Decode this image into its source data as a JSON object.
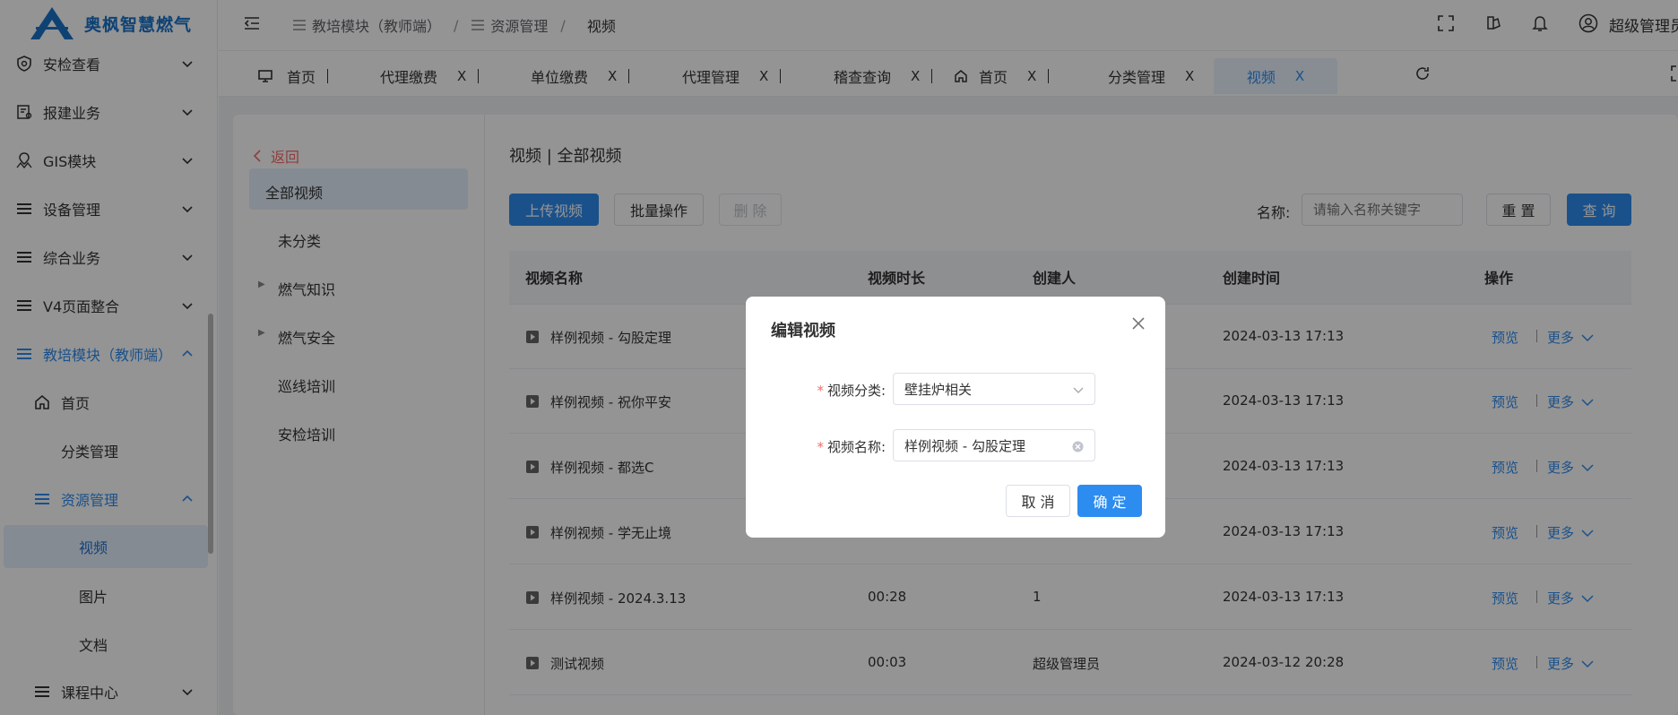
{
  "app": {
    "name": "奥枫智慧燃气"
  },
  "sidebar": {
    "items": [
      {
        "label": "安检查看",
        "icon": "shield-icon"
      },
      {
        "label": "报建业务",
        "icon": "form-icon"
      },
      {
        "label": "GIS模块",
        "icon": "map-icon"
      },
      {
        "label": "设备管理",
        "icon": "menu-icon"
      },
      {
        "label": "综合业务",
        "icon": "menu-icon"
      },
      {
        "label": "V4页面整合",
        "icon": "menu-icon"
      },
      {
        "label": "教培模块（教师端）",
        "icon": "menu-icon"
      },
      {
        "label": "首页",
        "icon": "home-icon"
      },
      {
        "label": "分类管理"
      },
      {
        "label": "资源管理",
        "icon": "menu-icon"
      },
      {
        "label": "视频"
      },
      {
        "label": "图片"
      },
      {
        "label": "文档"
      },
      {
        "label": "课程中心",
        "icon": "menu-icon"
      }
    ]
  },
  "header": {
    "breadcrumb": [
      "教培模块（教师端）",
      "资源管理",
      "视频"
    ],
    "user": "超级管理员"
  },
  "tabs": [
    "首页",
    "代理缴费",
    "单位缴费",
    "代理管理",
    "稽查查询",
    "首页",
    "分类管理",
    "视频"
  ],
  "tab_close": "X",
  "leftnav": {
    "back": "返回",
    "items": [
      "全部视频",
      "未分类",
      "燃气知识",
      "燃气安全",
      "巡线培训",
      "安检培训"
    ]
  },
  "main": {
    "title": "视频 | 全部视频",
    "upload": "上传视频",
    "batch": "批量操作",
    "delete": "删 除",
    "name_label": "名称:",
    "name_placeholder": "请输入名称关键字",
    "reset": "重 置",
    "query": "查 询"
  },
  "table": {
    "headers": [
      "视频名称",
      "视频时长",
      "创建人",
      "创建时间",
      "操作"
    ],
    "rows": [
      {
        "name": "样例视频 - 勾股定理",
        "duration": "",
        "creator": "",
        "time": "2024-03-13 17:13"
      },
      {
        "name": "样例视频 - 祝你平安",
        "duration": "",
        "creator": "",
        "time": "2024-03-13 17:13"
      },
      {
        "name": "样例视频 - 都选C",
        "duration": "",
        "creator": "",
        "time": "2024-03-13 17:13"
      },
      {
        "name": "样例视频 - 学无止境",
        "duration": "",
        "creator": "",
        "time": "2024-03-13 17:13"
      },
      {
        "name": "样例视频 - 2024.3.13",
        "duration": "00:28",
        "creator": "1",
        "time": "2024-03-13 17:13"
      },
      {
        "name": "测试视频",
        "duration": "00:03",
        "creator": "超级管理员",
        "time": "2024-03-12 20:28"
      }
    ],
    "preview": "预览",
    "more": "更多"
  },
  "modal": {
    "title": "编辑视频",
    "category_label": "视频分类:",
    "category_value": "壁挂炉相关",
    "name_label": "视频名称:",
    "name_value": "样例视频 - 勾股定理",
    "cancel": "取 消",
    "confirm": "确 定"
  },
  "colors": {
    "primary": "#2d8cf0",
    "danger": "#f56c6c",
    "brand": "#1a73c8"
  }
}
